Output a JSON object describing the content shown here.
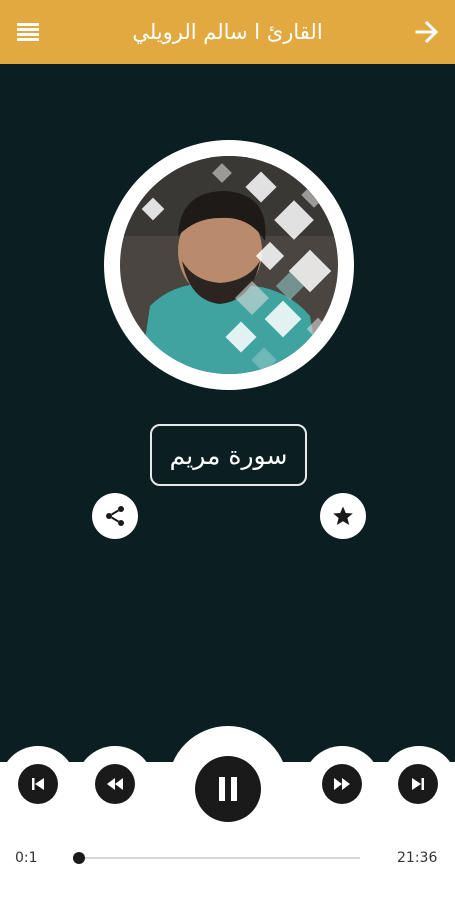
{
  "header": {
    "title": "القارئ ا سالم الرويلي",
    "menu_icon": "hamburger-menu-icon",
    "back_icon": "arrow-right-icon",
    "color": "#e2a940"
  },
  "content": {
    "surah_name": "سورة مريم",
    "background": "#0b1f22"
  },
  "actions": {
    "share_icon": "share-icon",
    "favorite_icon": "star-icon"
  },
  "player": {
    "current_time": "0:1",
    "total_time": "21:36",
    "state": "playing",
    "progress": 0.0,
    "controls": [
      "skip-previous-icon",
      "rewind-icon",
      "pause-icon",
      "fast-forward-icon",
      "skip-next-icon"
    ]
  }
}
